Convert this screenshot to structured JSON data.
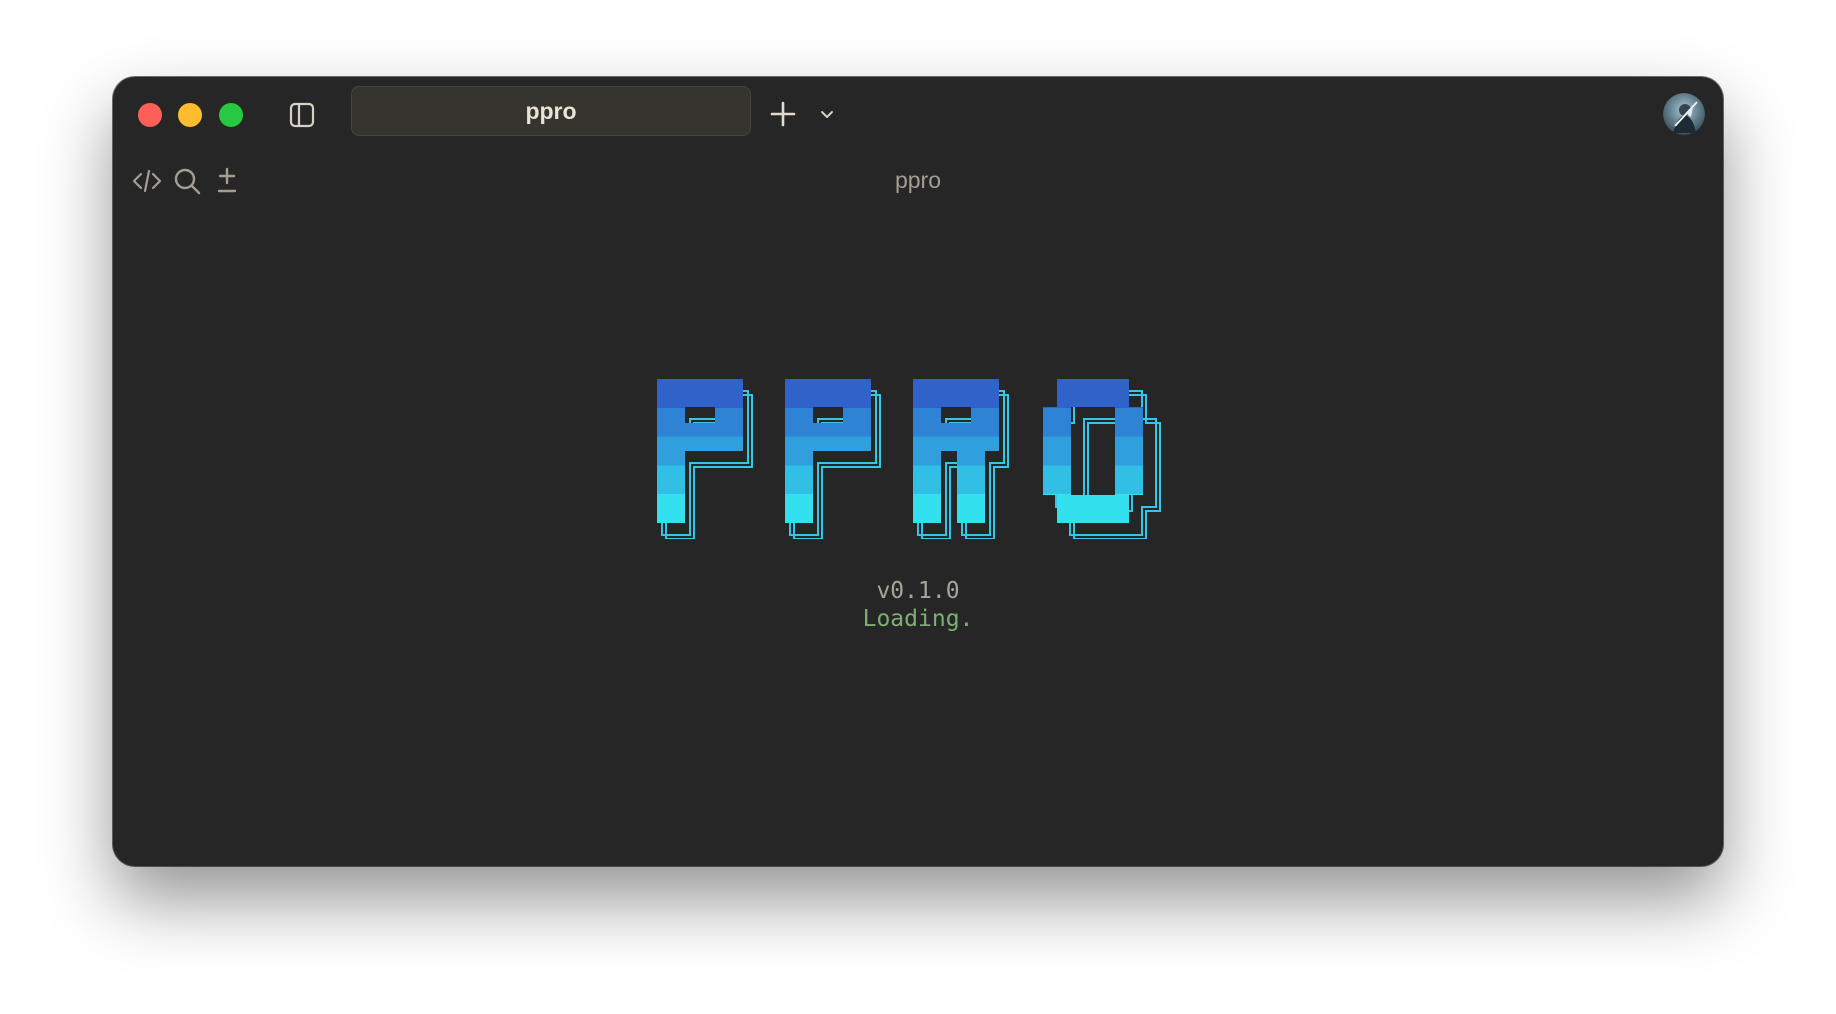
{
  "window": {
    "tab_title": "ppro",
    "pane_title": "ppro",
    "traffic_lights": {
      "close_color": "#fe5f57",
      "minimize_color": "#febc2e",
      "zoom_color": "#28c840"
    },
    "icons": {
      "sidebar_toggle": "sidebar-icon",
      "new_tab": "plus-icon",
      "tab_menu": "chevron-down-icon",
      "avatar": "user-avatar",
      "code": "code-icon",
      "search": "search-icon",
      "plus_minus": "plus-minus-icon"
    }
  },
  "content": {
    "logo_text": "PPRO",
    "version": "v0.1.0",
    "status": "Loading.",
    "colors": {
      "logo_top": "#3062c9",
      "logo_mid": "#2fa3e0",
      "logo_bottom": "#33e0ee",
      "status": "#7fae73",
      "version": "#a9a49a"
    }
  }
}
